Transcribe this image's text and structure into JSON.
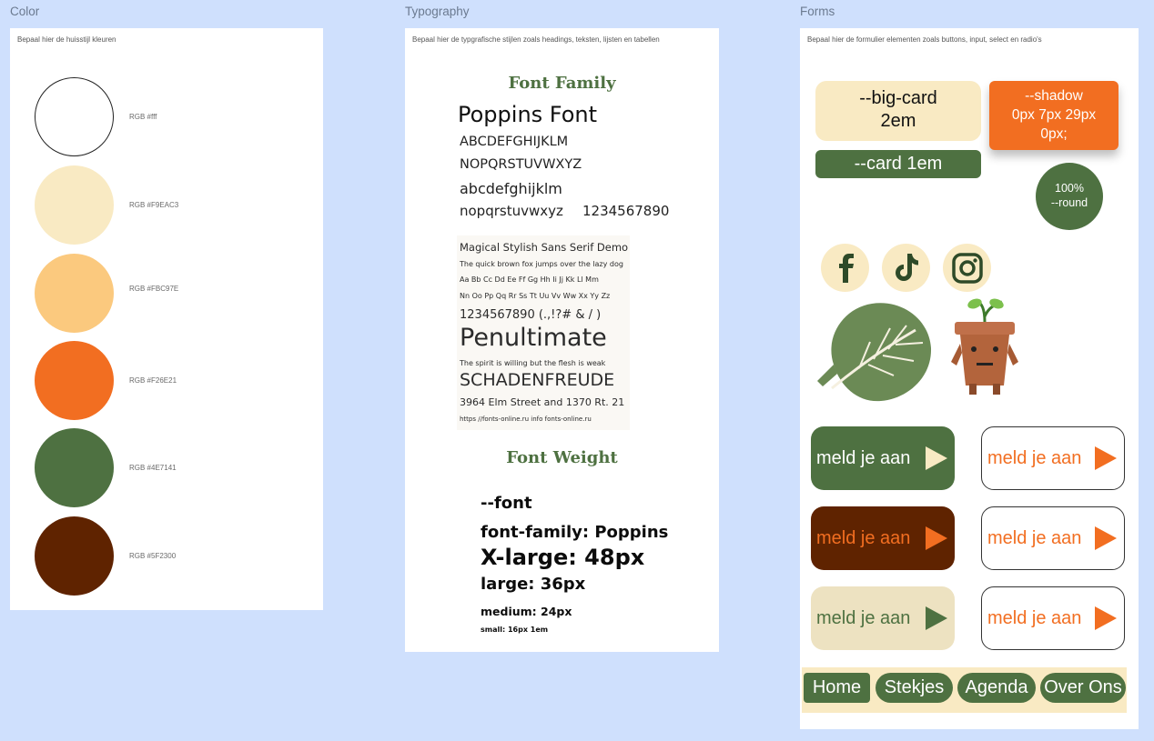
{
  "frames": {
    "color": {
      "title": "Color",
      "description": "Bepaal hier de huisstijl kleuren",
      "swatches": [
        {
          "label": "RGB #fff",
          "hex": "#ffffff"
        },
        {
          "label": "RGB #F9EAC3",
          "hex": "#F9EAC3"
        },
        {
          "label": "RGB #FBC97E",
          "hex": "#FBC97E"
        },
        {
          "label": "RGB #F26E21",
          "hex": "#F26E21"
        },
        {
          "label": "RGB #4E7141",
          "hex": "#4E7141"
        },
        {
          "label": "RGB #5F2300",
          "hex": "#5F2300"
        }
      ]
    },
    "typography": {
      "title": "Typography",
      "description": "Bepaal hier de typgrafische stijlen zoals headings, teksten, lijsten en tabellen",
      "font_family_heading": "Font Family",
      "font_name": "Poppins Font",
      "alphabet": [
        "ABCDEFGHIJKLM",
        "NOPQRSTUVWXYZ",
        "abcdefghijklm"
      ],
      "alphabet_last_letters": "nopqrstuvwxyz",
      "alphabet_last_numbers": "1234567890",
      "specimen": {
        "title": "Magical Stylish Sans Serif Demo",
        "pangram": "The quick brown fox jumps over the lazy dog",
        "pairs1": "Aa Bb Cc Dd Ee Ff Gg Hh Ii Jj Kk Ll Mm",
        "pairs2": "Nn Oo Pp Qq Rr Ss Tt Uu Vv Ww Xx Yy Zz",
        "digits": "1234567890 (.,!?#  & /     )",
        "display": "Penultimate",
        "phrase": "The spirit is willing but the flesh is weak",
        "caps": "SCHADENFREUDE",
        "address": "3964 Elm Street and 1370 Rt. 21",
        "footer": "https //fonts-online.ru     info fonts-online.ru"
      },
      "font_weight_heading": "Font Weight",
      "weights": {
        "var": "--font",
        "family": "font-family: Poppins",
        "xlarge": "X-large: 48px",
        "large": "large: 36px",
        "medium": "medium: 24px",
        "small": "small: 16px 1em"
      }
    },
    "forms": {
      "title": "Forms",
      "description": "Bepaal hier de formulier elementen zoals buttons, input, select en radio's",
      "big_card_line1": "--big-card",
      "big_card_line2": "2em",
      "shadow_line1": "--shadow",
      "shadow_line2": "0px 7px 29px",
      "shadow_line3": "0px;",
      "card": "--card 1em",
      "round_line1": "100%",
      "round_line2": "--round",
      "social": [
        "facebook-icon",
        "tiktok-icon",
        "instagram-icon"
      ],
      "cta_label": "meld je aan",
      "nav": [
        "Home",
        "Stekjes",
        "Agenda",
        "Over Ons"
      ]
    }
  }
}
